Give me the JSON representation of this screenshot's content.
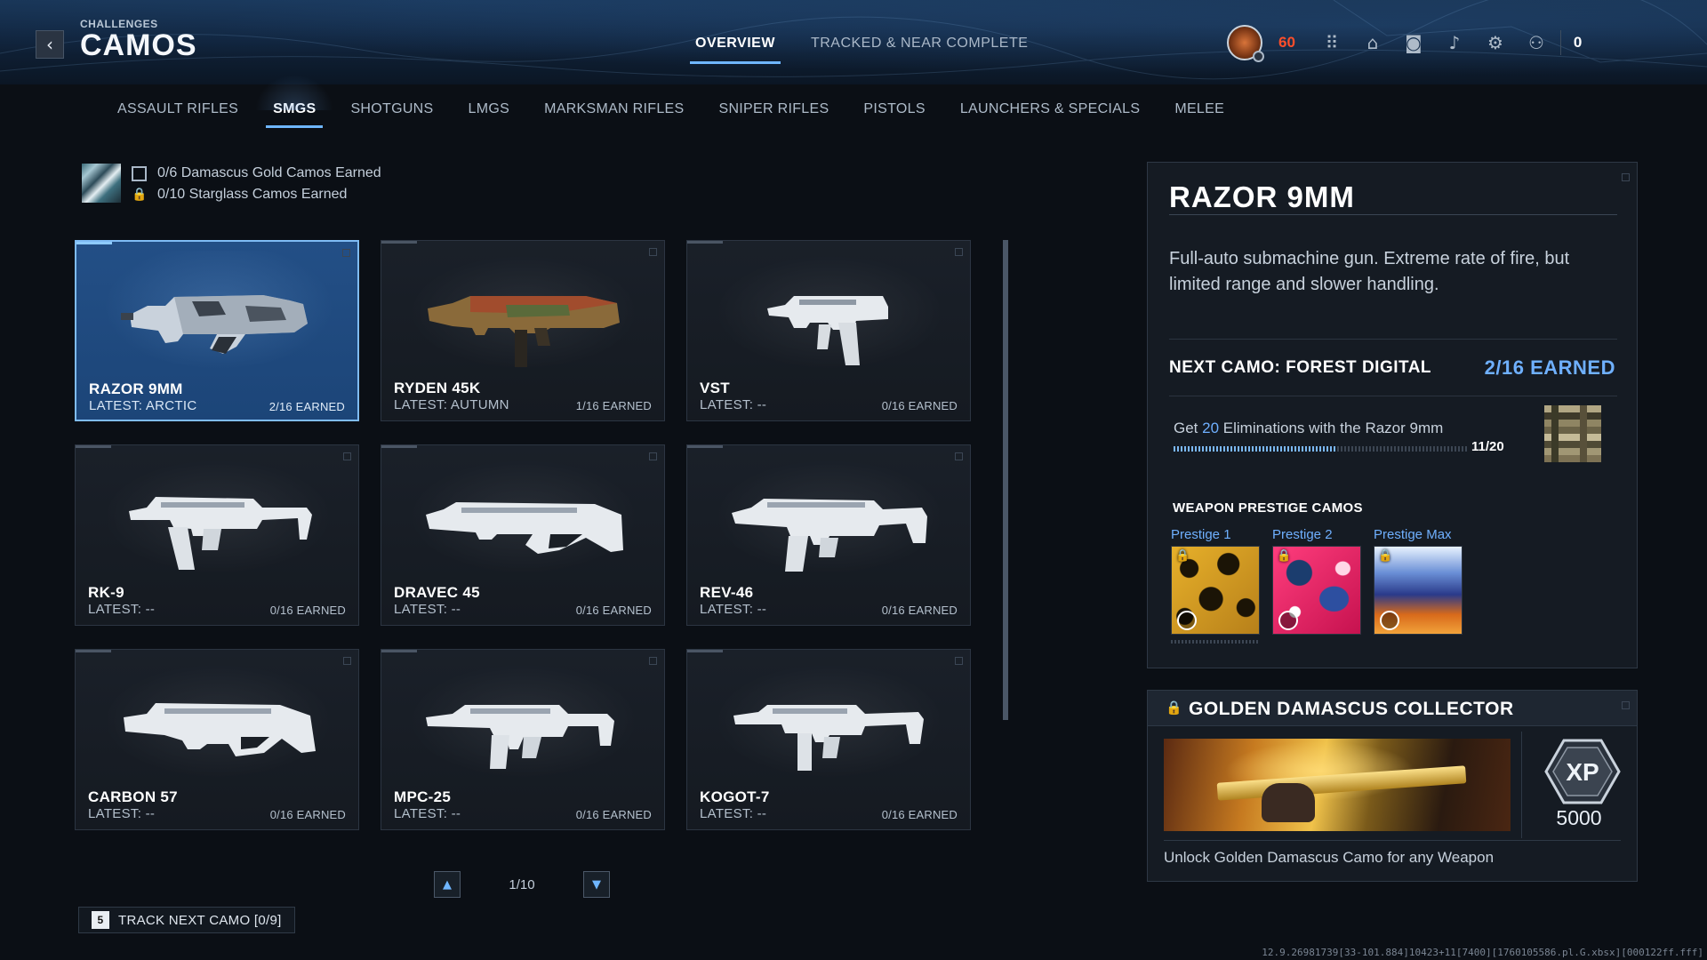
{
  "header": {
    "breadcrumb": "CHALLENGES",
    "title": "CAMOS",
    "tabs": [
      {
        "label": "OVERVIEW",
        "active": true
      },
      {
        "label": "TRACKED & NEAR COMPLETE",
        "active": false
      }
    ],
    "player_level": "60",
    "party_count": "0",
    "icons": [
      "rank-badge-icon",
      "apps-grid-icon",
      "store-icon",
      "camera-icon",
      "bell-icon",
      "gear-icon",
      "social-icon"
    ],
    "level_color": "#ff4e2a"
  },
  "categories": [
    {
      "label": "ASSAULT RIFLES",
      "active": false
    },
    {
      "label": "SMGS",
      "active": true
    },
    {
      "label": "SHOTGUNS",
      "active": false
    },
    {
      "label": "LMGS",
      "active": false
    },
    {
      "label": "MARKSMAN RIFLES",
      "active": false
    },
    {
      "label": "SNIPER RIFLES",
      "active": false
    },
    {
      "label": "PISTOLS",
      "active": false
    },
    {
      "label": "LAUNCHERS & SPECIALS",
      "active": false
    },
    {
      "label": "MELEE",
      "active": false
    }
  ],
  "summary": {
    "gold": "0/6 Damascus Gold Camos Earned",
    "starglass": "0/10 Starglass Camos Earned"
  },
  "weapons": [
    {
      "name": "RAZOR 9MM",
      "latest": "LATEST: ARCTIC",
      "earned": "2/16 EARNED",
      "selected": true
    },
    {
      "name": "RYDEN 45K",
      "latest": "LATEST: AUTUMN",
      "earned": "1/16 EARNED",
      "selected": false
    },
    {
      "name": "VST",
      "latest": "LATEST: --",
      "earned": "0/16 EARNED",
      "selected": false
    },
    {
      "name": "RK-9",
      "latest": "LATEST: --",
      "earned": "0/16 EARNED",
      "selected": false
    },
    {
      "name": "DRAVEC 45",
      "latest": "LATEST: --",
      "earned": "0/16 EARNED",
      "selected": false
    },
    {
      "name": "REV-46",
      "latest": "LATEST: --",
      "earned": "0/16 EARNED",
      "selected": false
    },
    {
      "name": "CARBON 57",
      "latest": "LATEST: --",
      "earned": "0/16 EARNED",
      "selected": false
    },
    {
      "name": "MPC-25",
      "latest": "LATEST: --",
      "earned": "0/16 EARNED",
      "selected": false
    },
    {
      "name": "KOGOT-7",
      "latest": "LATEST: --",
      "earned": "0/16 EARNED",
      "selected": false
    }
  ],
  "pager": {
    "text": "1/10"
  },
  "track_button": {
    "key": "5",
    "label": "TRACK NEXT CAMO [0/9]"
  },
  "detail": {
    "title": "RAZOR 9MM",
    "description": "Full-auto submachine gun. Extreme rate of fire, but limited range and slower handling.",
    "next_camo": "NEXT CAMO: FOREST DIGITAL",
    "next_count": "2/16 EARNED",
    "challenge_pre": "Get ",
    "challenge_num": "20",
    "challenge_post": " Eliminations with the Razor 9mm",
    "progress_text": "11/20",
    "progress_value": 0.55,
    "prestige_header": "WEAPON PRESTIGE CAMOS",
    "prestige": [
      {
        "label": "Prestige 1",
        "locked": true
      },
      {
        "label": "Prestige 2",
        "locked": true
      },
      {
        "label": "Prestige Max",
        "locked": true
      }
    ],
    "accent": "#6fb0ff"
  },
  "reward": {
    "title": "GOLDEN DAMASCUS COLLECTOR",
    "xp_label": "XP",
    "xp_value": "5000",
    "description": "Unlock Golden Damascus Camo for any Weapon"
  },
  "debug_text": "12.9.26981739[33-101.884]10423+11[7400][1760105586.pl.G.xbsx][000122ff.fff]"
}
